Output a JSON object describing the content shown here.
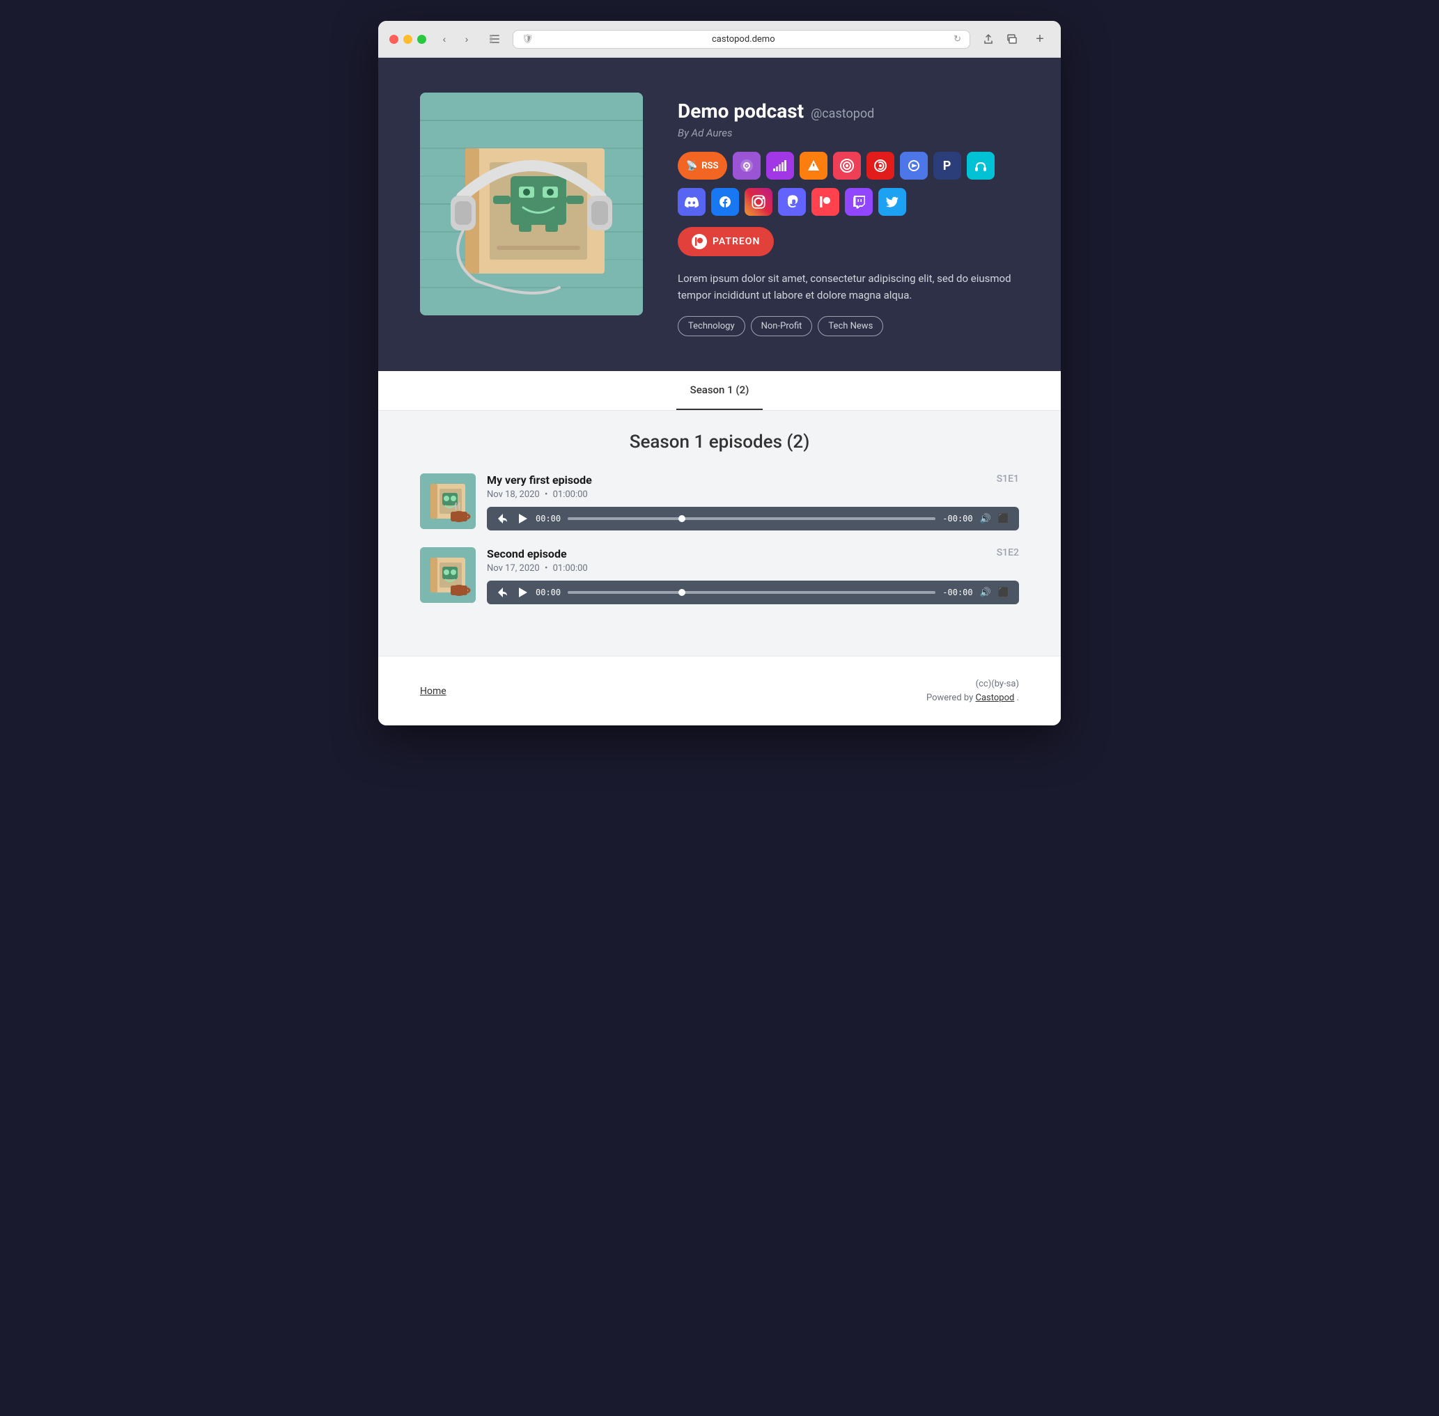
{
  "browser": {
    "url": "castopod.demo",
    "tab_title": "castopod.demo"
  },
  "hero": {
    "podcast_title": "Demo podcast",
    "podcast_handle": "@castopod",
    "author": "By Ad Aures",
    "description": "Lorem ipsum dolor sit amet, consectetur adipiscing elit, sed do eiusmod tempor incididunt ut labore et dolore magna alqua.",
    "tags": [
      "Technology",
      "Non-Profit",
      "Tech News"
    ],
    "patreon_label": "PATREON",
    "platforms": [
      {
        "name": "RSS",
        "label": "RSS",
        "icon": "📡"
      },
      {
        "name": "Apple Podcasts",
        "icon": "🎙"
      },
      {
        "name": "Deezer",
        "icon": "≡"
      },
      {
        "name": "Overcast",
        "icon": "▶"
      },
      {
        "name": "Pocket Casts",
        "icon": "◉"
      },
      {
        "name": "Podchaser",
        "icon": "◎"
      },
      {
        "name": "Player FM",
        "icon": "P"
      },
      {
        "name": "Podcast Index",
        "icon": "P"
      },
      {
        "name": "Headphones",
        "icon": "🎧"
      }
    ],
    "socials": [
      {
        "name": "Discord",
        "icon": "discord"
      },
      {
        "name": "Facebook",
        "icon": "facebook"
      },
      {
        "name": "Instagram",
        "icon": "instagram"
      },
      {
        "name": "Mastodon",
        "icon": "mastodon"
      },
      {
        "name": "Patreon social",
        "icon": "patreon"
      },
      {
        "name": "Twitch",
        "icon": "twitch"
      },
      {
        "name": "Twitter",
        "icon": "twitter"
      }
    ]
  },
  "seasons": {
    "active_tab": "Season 1 (2)"
  },
  "episodes_section": {
    "title": "Season 1 episodes (2)",
    "episodes": [
      {
        "title": "My very first episode",
        "date": "Nov 18, 2020",
        "duration": "01:00:00",
        "code": "S1E1",
        "current_time": "00:00",
        "remaining_time": "-00:00"
      },
      {
        "title": "Second episode",
        "date": "Nov 17, 2020",
        "duration": "01:00:00",
        "code": "S1E2",
        "current_time": "00:00",
        "remaining_time": "-00:00"
      }
    ]
  },
  "footer": {
    "home_link": "Home",
    "license": "(cc)(by-sa)",
    "powered_by_text": "Powered by",
    "powered_by_link": "Castopod",
    "powered_by_suffix": "."
  }
}
